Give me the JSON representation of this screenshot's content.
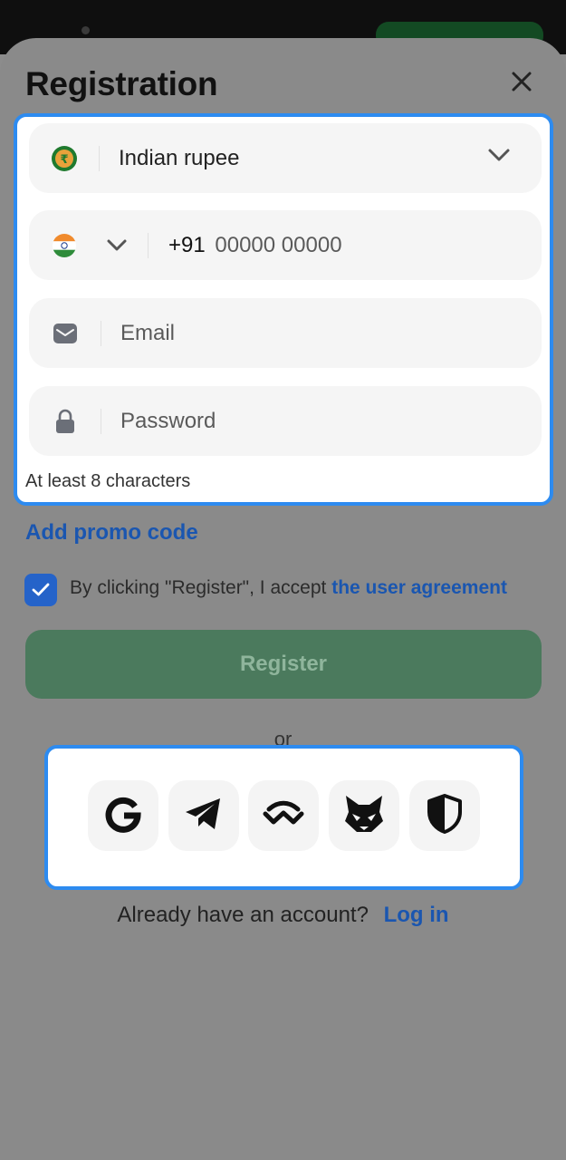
{
  "header": {
    "title": "Registration",
    "close_icon": "close-icon"
  },
  "form": {
    "currency": {
      "value": "Indian rupee",
      "icon": "rupee-coin-icon"
    },
    "phone": {
      "country_code": "+91",
      "placeholder": "00000 00000",
      "icon": "india-flag-icon"
    },
    "email": {
      "placeholder": "Email",
      "icon": "envelope-icon"
    },
    "password": {
      "placeholder": "Password",
      "icon": "lock-icon",
      "hint": "At least 8 characters"
    }
  },
  "promo_label": "Add promo code",
  "agreement": {
    "checked": true,
    "text": "By clicking \"Register\", I accept",
    "link": "the user agreement"
  },
  "register_label": "Register",
  "or_label": "or",
  "social": [
    "google-icon",
    "telegram-icon",
    "walletconnect-icon",
    "metamask-fox-icon",
    "shield-icon"
  ],
  "footer": {
    "question": "Already have an account?",
    "login_label": "Log in"
  },
  "colors": {
    "accent_blue": "#1a56b0",
    "highlight_border": "#2d8bf0",
    "register_green": "#4b7a5d"
  }
}
